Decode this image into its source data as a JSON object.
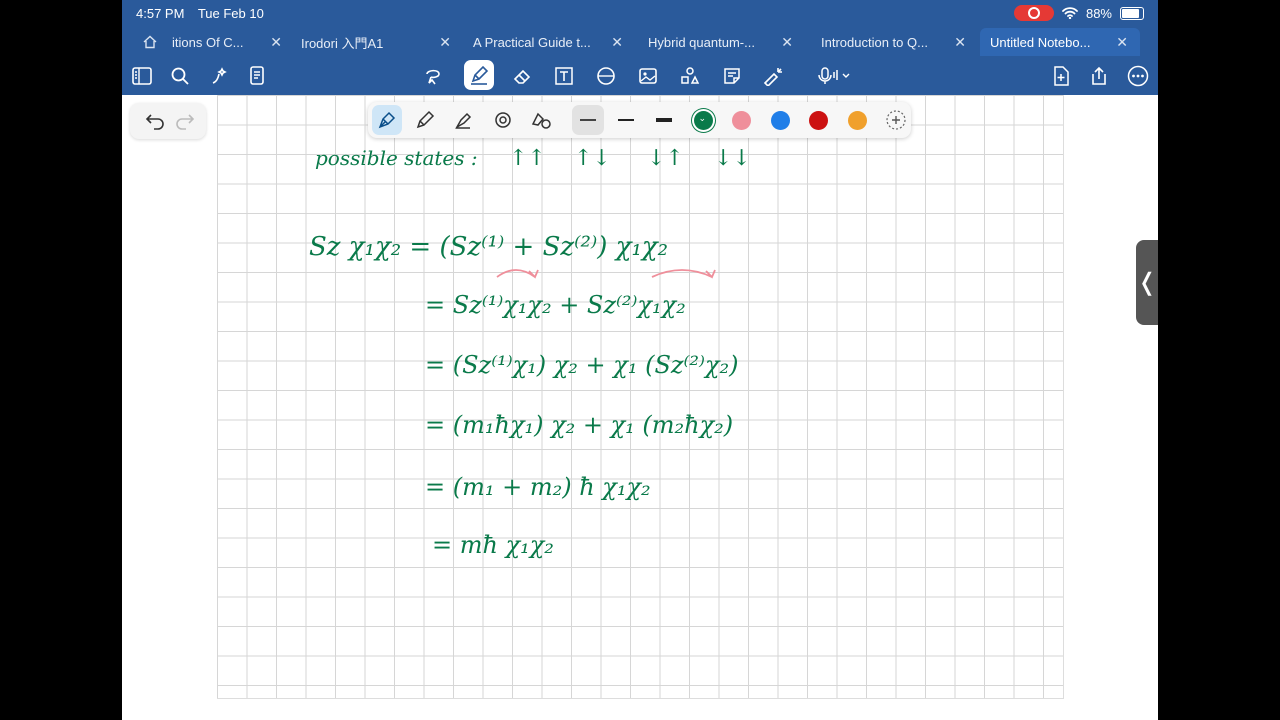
{
  "status": {
    "time": "4:57 PM",
    "date": "Tue Feb 10",
    "battery": "88%"
  },
  "tabs": [
    {
      "label": "itions Of C...",
      "active": false
    },
    {
      "label": "Irodori 入門A1",
      "active": false
    },
    {
      "label": "A Practical Guide t...",
      "active": false
    },
    {
      "label": "Hybrid quantum-...",
      "active": false
    },
    {
      "label": "Introduction to Q...",
      "active": false
    },
    {
      "label": "Untitled Notebo...",
      "active": true
    }
  ],
  "pen_colors": [
    "#0a7a4a",
    "#ef8f9b",
    "#1f7ee8",
    "#cc1111",
    "#f0a02c"
  ],
  "ink": {
    "color": "#0a7a4a",
    "accent_color": "#ef8f9b",
    "lines": [
      "possible states :",
      "↑↑",
      "↑↓",
      "↓↑",
      "↓↓",
      "Sz χ₁χ₂ = (Sz⁽¹⁾ + Sz⁽²⁾) χ₁χ₂",
      "= Sz⁽¹⁾χ₁χ₂ + Sz⁽²⁾χ₁χ₂",
      "= (Sz⁽¹⁾χ₁) χ₂ + χ₁ (Sz⁽²⁾χ₂)",
      "= (m₁ħχ₁) χ₂ + χ₁ (m₂ħχ₂)",
      "= (m₁ + m₂) ħ χ₁χ₂",
      "= mħ χ₁χ₂"
    ]
  }
}
